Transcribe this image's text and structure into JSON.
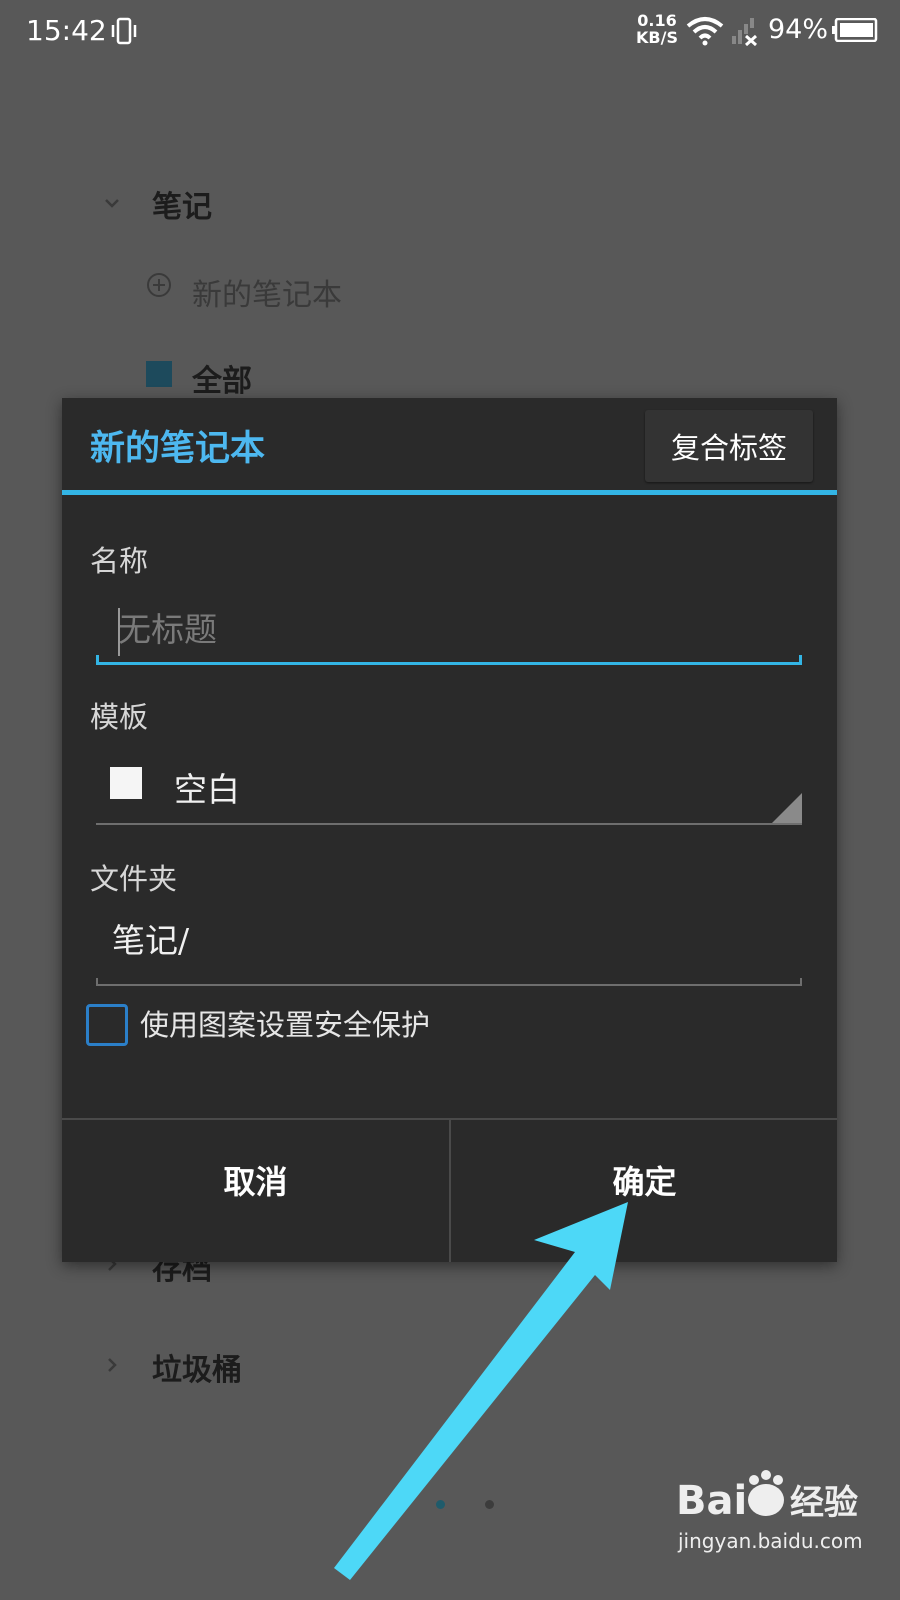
{
  "status_bar": {
    "time": "15:42",
    "net_speed": "0.16",
    "net_unit": "KB/S",
    "battery": "94%"
  },
  "drawer": {
    "section_notes": "笔记",
    "new_notebook": "新的笔记本",
    "all": "全部",
    "archive": "存档",
    "trash": "垃圾桶"
  },
  "dialog": {
    "title": "新的笔记本",
    "tag_button": "复合标签",
    "name_label": "名称",
    "name_placeholder": "无标题",
    "template_label": "模板",
    "template_value": "空白",
    "folder_label": "文件夹",
    "folder_value": "笔记/",
    "pattern_lock_label": "使用图案设置安全保护",
    "pattern_lock_checked": false,
    "cancel": "取消",
    "ok": "确定"
  },
  "colors": {
    "accent": "#33b5e5",
    "title": "#4db8f0",
    "arrow": "#4dd8f7",
    "dim_background": "#585858"
  },
  "pager": {
    "count": 3,
    "active": 1
  },
  "watermark": {
    "brand": "Bai",
    "brand2": "经验",
    "url": "jingyan.baidu.com"
  }
}
